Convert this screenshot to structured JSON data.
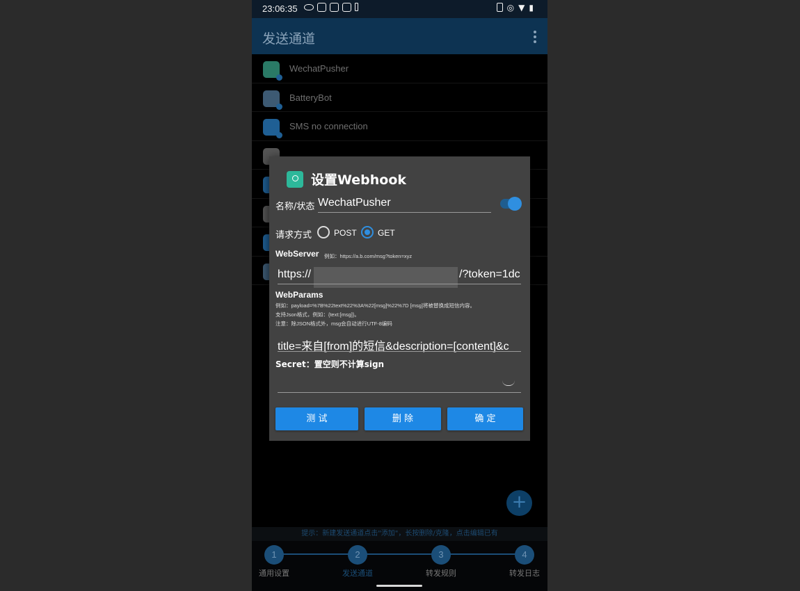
{
  "status_bar": {
    "time": "23:06:35"
  },
  "app_bar": {
    "title": "发送通道"
  },
  "channels": [
    {
      "name": "WechatPusher",
      "icon": "webhook-icon",
      "color": "#2a7a66"
    },
    {
      "name": "BatteryBot",
      "icon": "telegram-icon",
      "color": "#3d5a73"
    },
    {
      "name": "SMS no connection",
      "icon": "sms-icon",
      "color": "#1f5f94"
    },
    {
      "name": "",
      "icon": "avatar-icon",
      "color": "#555555"
    },
    {
      "name": "",
      "icon": "app-icon",
      "color": "#1f5f94"
    },
    {
      "name": "",
      "icon": "avatar-icon",
      "color": "#555555"
    },
    {
      "name": "",
      "icon": "app-icon",
      "color": "#1f5f94"
    },
    {
      "name": "",
      "icon": "telegram-icon",
      "color": "#3d5a73"
    }
  ],
  "dialog": {
    "title": "设置Webhook",
    "name_label": "名称/状态",
    "name_value": "WechatPusher",
    "enabled": true,
    "method_label": "请求方式",
    "method_options": [
      "POST",
      "GET"
    ],
    "method_selected": "GET",
    "webserver_title": "WebServer",
    "webserver_hint": "例如：https://a.b.com/msg?token=xyz",
    "webserver_prefix": "https://",
    "webserver_suffix": "/?token=1dc",
    "webparams_title": "WebParams",
    "webparams_hint_1": "例如：payload=%7B%22text%22%3A%22[msg]%22%7D [msg]将被替换成短信内容。",
    "webparams_hint_2": "支持Json格式，例如：{text:[msg]}。",
    "webparams_hint_3": "注意：除JSON格式外，msg会自动进行UTF-8编码",
    "webparams_value": "title=来自[from]的短信&description=[content]&c",
    "secret_label": "Secret：置空则不计算sign",
    "secret_value": "",
    "buttons": {
      "test": "测 试",
      "delete": "删 除",
      "confirm": "确 定"
    }
  },
  "hint": "提示：新建发送通道点击\"添加\"，长按删除/克隆，点击编辑已有",
  "fab_label": "+",
  "steps": [
    {
      "num": "1",
      "label": "通用设置"
    },
    {
      "num": "2",
      "label": "发送通道"
    },
    {
      "num": "3",
      "label": "转发规则"
    },
    {
      "num": "4",
      "label": "转发日志"
    }
  ],
  "active_step": 2
}
